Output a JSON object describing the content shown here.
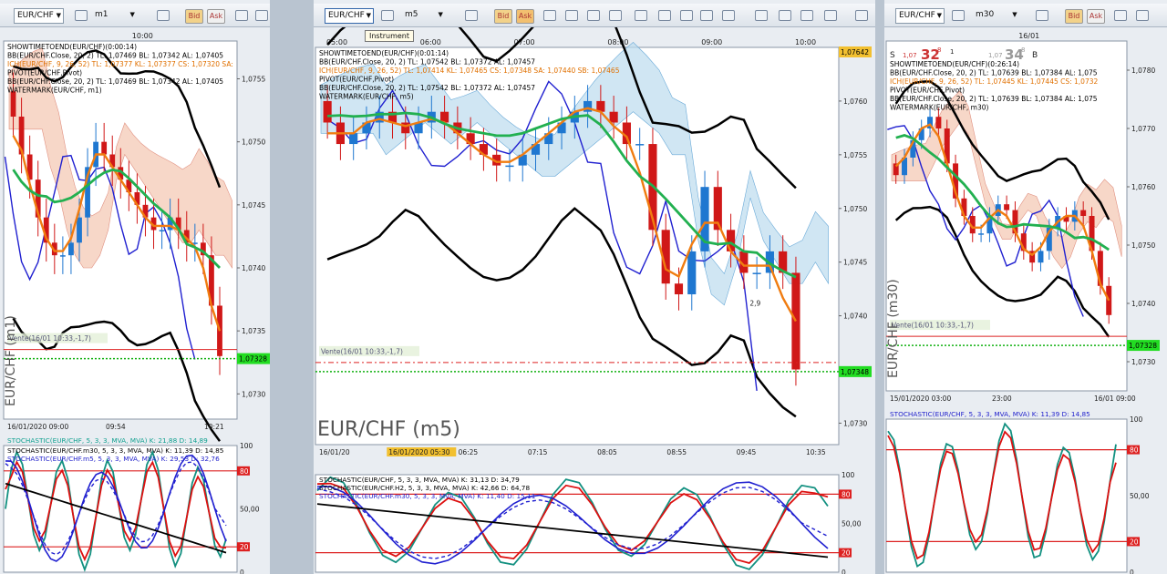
{
  "panels": [
    {
      "symbol": "EUR/CHF",
      "period": "m1",
      "time_label_top": "10:00",
      "legend": [
        {
          "text": "SHOWTIMETOEND(EUR/CHF)(0:00:14)",
          "color": "#000000"
        },
        {
          "text": "BB(EUR/CHF.Close, 20, 2)  TL: 1,07469  BL: 1,07342  AL: 1,07405",
          "color": "#000000"
        },
        {
          "text": "ICH(EUR/CHF, 9, 26, 52)  TL: 1,07377  KL: 1,07377  CS: 1,07320  SA:",
          "color": "#e07000"
        },
        {
          "text": "PIVOT(EUR/CHF,Pivot)",
          "color": "#000000"
        },
        {
          "text": "BB(EUR/CHF.Close, 20, 2)  TL: 1,07469  BL: 1,07342  AL: 1,07405",
          "color": "#000000"
        },
        {
          "text": "WATERMARK(EUR/CHF, m1)",
          "color": "#000000"
        }
      ],
      "price_ticks": [
        "1,0755",
        "1,0750",
        "1,0745",
        "1,0740",
        "1,0735",
        "1,0730"
      ],
      "current_price": "1,07328",
      "order_label": "Vente(16/01 10:33,-1,7)",
      "watermark": "EUR/CHF (m1)",
      "time_ticks": [
        "16/01/2020 09:00",
        "09:54",
        "10:21"
      ],
      "stochastic_header": "STOCHASTIC(EUR/CHF, 5, 3, 3, MVA, MVA)  K: 21,88  D: 14,89",
      "stochastic_lines": [
        {
          "text": "STOCHASTIC(EUR/CHF.m30, 5, 3, 3, MVA, MVA)  K: 11,39  D: 14,85",
          "color": "#000000"
        },
        {
          "text": "STOCHASTIC(EUR/CHF.m5, 5, 3, 3, MVA, MVA)  K: 29,53  D: 32,76",
          "color": "#2222cc"
        }
      ],
      "osc_ticks": [
        "100",
        "80",
        "50,00",
        "20",
        "0"
      ]
    },
    {
      "symbol": "EUR/CHF",
      "period": "m5",
      "tooltip": "Instrument",
      "time_ticks_top": [
        "05:00",
        "06:00",
        "07:00",
        "08:00",
        "09:00",
        "10:00"
      ],
      "legend": [
        {
          "text": "SHOWTIMETOEND(EUR/CHF)(0:01:14)",
          "color": "#000000"
        },
        {
          "text": "BB(EUR/CHF.Close, 20, 2)  TL: 1,07542  BL: 1,07372  AL: 1,07457",
          "color": "#000000"
        },
        {
          "text": "ICH(EUR/CHF, 9, 26, 52)  TL: 1,07414  KL: 1,07465  CS: 1,07348  SA: 1,07440  SB: 1,07465",
          "color": "#e07000"
        },
        {
          "text": "PIVOT(EUR/CHF,Pivot)",
          "color": "#000000"
        },
        {
          "text": "BB(EUR/CHF.Close, 20, 2)  TL: 1,07542  BL: 1,07372  AL: 1,07457",
          "color": "#000000"
        },
        {
          "text": "WATERMARK(EUR/CHF, m5)",
          "color": "#000000"
        }
      ],
      "price_ticks": [
        "1,0760",
        "1,0755",
        "1,0750",
        "1,0745",
        "1,0740",
        "1,0735",
        "1,0730"
      ],
      "top_price": "1,07642",
      "current_price": "1,07348",
      "order_label": "Vente(16/01 10:33,-1,7)",
      "watermark": "EUR/CHF (m5)",
      "pivot_label": "2,9",
      "time_ticks": [
        "16/01/20",
        "16/01/2020 05:30",
        "06:25",
        "07:15",
        "08:05",
        "08:55",
        "09:45",
        "10:35"
      ],
      "stochastic_lines": [
        {
          "text": "STOCHASTIC(EUR/CHF, 5, 3, 3, MVA, MVA)  K: 31,13  D: 34,79",
          "color": "#000000"
        },
        {
          "text": "STOCHASTIC(EUR/CHF.H2, 5, 3, 3, MVA, MVA)  K: 42,66  D: 64,78",
          "color": "#000000"
        },
        {
          "text": "STOCHASTIC(EUR/CHF.m30, 5, 3, 3, MVA, MVA)  K: 11,40  D: 15,11",
          "color": "#2222cc"
        }
      ],
      "osc_ticks": [
        "100",
        "80",
        "50,00",
        "20",
        "0"
      ]
    },
    {
      "symbol": "EUR/CHF",
      "period": "m30",
      "time_label_top": "16/01",
      "sell_label": "S",
      "sell_price": "1,07",
      "sell_big": "32",
      "sell_frac": "8",
      "spread": "1",
      "buy_price": "1,07",
      "buy_big": "34",
      "buy_frac": "8",
      "buy_label": "B",
      "legend": [
        {
          "text": "SHOWTIMETOEND(EUR/CHF)(0:26:14)",
          "color": "#000000"
        },
        {
          "text": "BB(EUR/CHF.Close, 20, 2)  TL: 1,07639  BL: 1,07384  AL: 1,075",
          "color": "#000000"
        },
        {
          "text": "ICH(EUR/CHF, 9, 26, 52)  TL: 1,07445  KL: 1,07445  CS: 1,0732",
          "color": "#e07000"
        },
        {
          "text": "PIVOT(EUR/CHF,Pivot)",
          "color": "#000000"
        },
        {
          "text": "BB(EUR/CHF.Close, 20, 2)  TL: 1,07639  BL: 1,07384  AL: 1,075",
          "color": "#000000"
        },
        {
          "text": "WATERMARK(EUR/CHF, m30)",
          "color": "#000000"
        }
      ],
      "price_ticks": [
        "1,0780",
        "1,0770",
        "1,0760",
        "1,0750",
        "1,0740",
        "1,0730"
      ],
      "current_price": "1,07328",
      "order_label": "Vente(16/01 10:33,-1,7)",
      "watermark": "EUR/CHF (m30)",
      "time_ticks": [
        "15/01/2020 03:00",
        "23:00",
        "16/01 09:00"
      ],
      "stochastic_lines": [
        {
          "text": "STOCHASTIC(EUR/CHF, 5, 3, 3, MVA, MVA)  K: 11,39  D: 14,85",
          "color": "#2222cc"
        }
      ],
      "osc_ticks": [
        "100",
        "80",
        "50,00",
        "20",
        "0"
      ]
    }
  ],
  "toolbar": {
    "bid_label": "Bid",
    "ask_label": "Ask"
  },
  "colors": {
    "candle_up": "#1f77d0",
    "candle_down": "#d01818",
    "bollinger": "#000000",
    "ichimoku_tenkan": "#f07c10",
    "ichimoku_kijun": "#22b050",
    "ichimoku_chikou": "#2020d0",
    "cloud_bear": "#f4c6b0",
    "cloud_bull": "#bcdcee",
    "current_price_bg": "#22dd22"
  },
  "chart_data": [
    {
      "type": "candlestick",
      "title": "EUR/CHF (m1)",
      "x_range": [
        "09:00",
        "10:33"
      ],
      "y_range": [
        1.0728,
        1.0758
      ],
      "close": [
        1.0752,
        1.0749,
        1.0747,
        1.0744,
        1.0742,
        1.0741,
        1.0741,
        1.0742,
        1.0744,
        1.0748,
        1.075,
        1.0749,
        1.0748,
        1.0747,
        1.0746,
        1.0745,
        1.0744,
        1.0743,
        1.0743,
        1.0744,
        1.0743,
        1.0742,
        1.0742,
        1.0741,
        1.0737,
        1.0733
      ],
      "last": 1.07328
    },
    {
      "type": "candlestick",
      "title": "EUR/CHF (m5)",
      "x_range": [
        "05:00",
        "10:35"
      ],
      "y_range": [
        1.0728,
        1.0765
      ],
      "close": [
        1.0758,
        1.0756,
        1.0757,
        1.0758,
        1.0759,
        1.0758,
        1.0757,
        1.0758,
        1.0759,
        1.0758,
        1.0757,
        1.0756,
        1.0755,
        1.0754,
        1.0754,
        1.0755,
        1.0756,
        1.0757,
        1.0758,
        1.0759,
        1.076,
        1.0759,
        1.0758,
        1.0756,
        1.0756,
        1.0748,
        1.0743,
        1.0742,
        1.0746,
        1.0752,
        1.0748,
        1.0746,
        1.0744,
        1.0744,
        1.0746,
        1.0744,
        1.0735
      ],
      "last": 1.07348
    },
    {
      "type": "candlestick",
      "title": "EUR/CHF (m30)",
      "x_range": [
        "15/01 03:00",
        "16/01 10:30"
      ],
      "y_range": [
        1.0725,
        1.0785
      ],
      "close": [
        1.0762,
        1.0765,
        1.0768,
        1.077,
        1.0772,
        1.077,
        1.0764,
        1.0758,
        1.0755,
        1.0752,
        1.0752,
        1.0755,
        1.0757,
        1.0756,
        1.0752,
        1.0749,
        1.0747,
        1.0749,
        1.0753,
        1.0755,
        1.0754,
        1.0756,
        1.0755,
        1.0749,
        1.0743,
        1.0738
      ],
      "last": 1.07328
    }
  ]
}
